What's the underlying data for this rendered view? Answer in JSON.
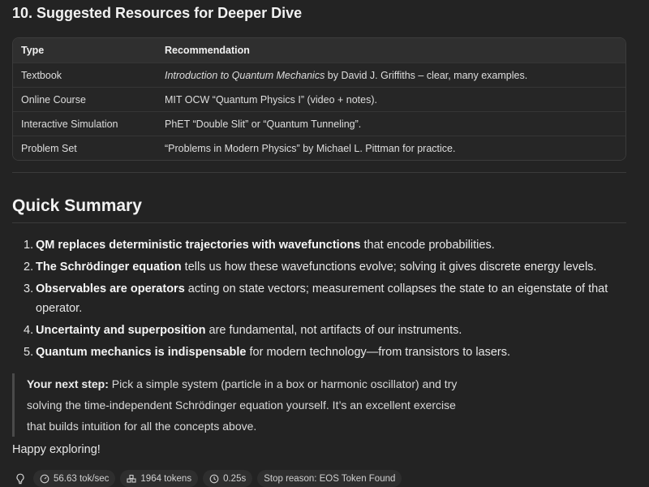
{
  "resources": {
    "heading": "10. Suggested Resources for Deeper Dive",
    "columns": [
      "Type",
      "Recommendation"
    ],
    "rows": [
      {
        "type": "Textbook",
        "rec_italic": "Introduction to Quantum Mechanics",
        "rec_rest": " by David J. Griffiths – clear, many examples."
      },
      {
        "type": "Online Course",
        "rec_italic": "",
        "rec_rest": "MIT OCW “Quantum Physics I” (video + notes)."
      },
      {
        "type": "Interactive Simulation",
        "rec_italic": "",
        "rec_rest": "PhET “Double Slit” or “Quantum Tunneling”."
      },
      {
        "type": "Problem Set",
        "rec_italic": "",
        "rec_rest": "“Problems in Modern Physics” by Michael L. Pittman for practice."
      }
    ]
  },
  "summary": {
    "heading": "Quick Summary",
    "items": [
      {
        "num": "1.",
        "bold": "QM replaces deterministic trajectories with wavefunctions",
        "rest": " that encode probabilities."
      },
      {
        "num": "2.",
        "bold": "The Schrödinger equation",
        "rest": " tells us how these wavefunctions evolve; solving it gives discrete energy levels."
      },
      {
        "num": "3.",
        "bold": "Observables are operators",
        "rest": " acting on state vectors; measurement collapses the state to an eigenstate of that operator."
      },
      {
        "num": "4.",
        "bold": "Uncertainty and superposition",
        "rest": " are fundamental, not artifacts of our instruments."
      },
      {
        "num": "5.",
        "bold": "Quantum mechanics is indispensable",
        "rest": " for modern technology—from transistors to lasers."
      }
    ]
  },
  "next_step": {
    "bold": "Your next step:",
    "text": " Pick a simple system (particle in a box or harmonic oscillator) and try solving the time-independent Schrödinger equation yourself. It’s an excellent exercise that builds intuition for all the concepts above."
  },
  "closing": "Happy exploring!",
  "footer": {
    "speed": "56.63 tok/sec",
    "tokens": "1964 tokens",
    "time": "0.25s",
    "stop_reason": "Stop reason: EOS Token Found",
    "icons": [
      "lightbulb-icon",
      "gauge-icon",
      "tokens-icon",
      "clock-icon"
    ]
  }
}
